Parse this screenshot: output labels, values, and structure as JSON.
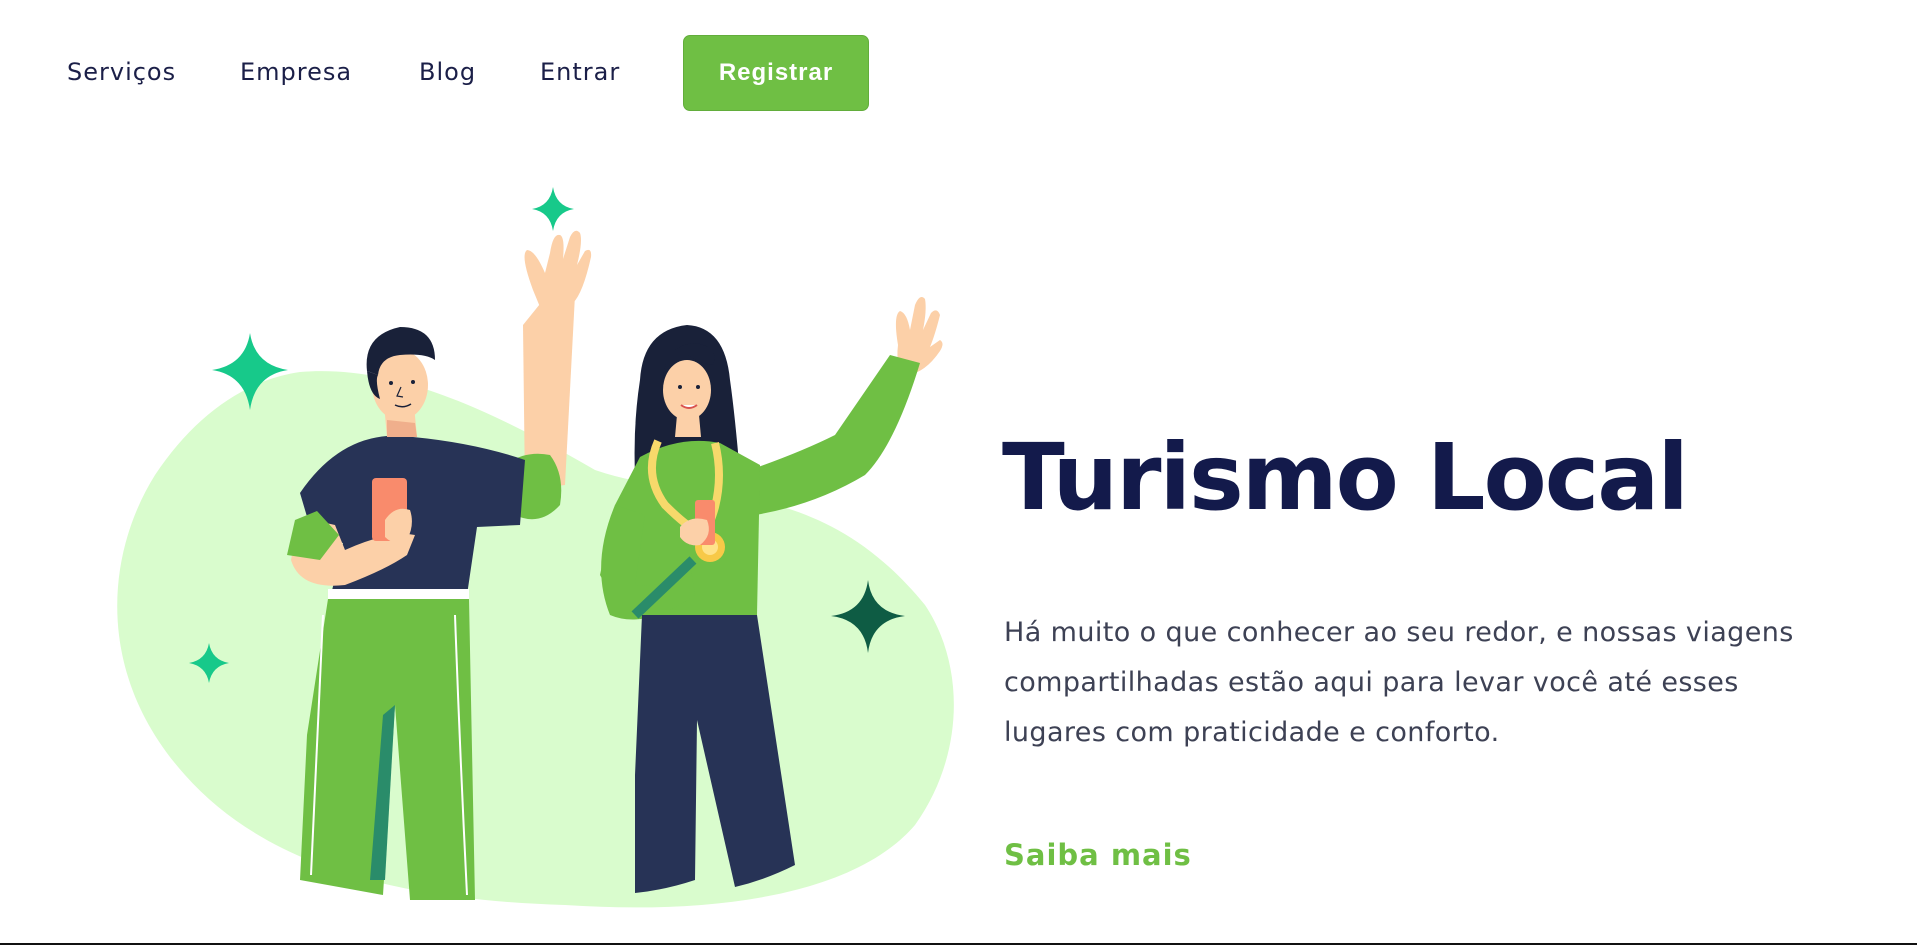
{
  "nav": {
    "links": [
      {
        "label": "Serviços"
      },
      {
        "label": "Empresa"
      },
      {
        "label": "Blog"
      },
      {
        "label": "Entrar"
      }
    ],
    "cta_label": "Registrar"
  },
  "hero": {
    "title": "Turismo Local",
    "description": "Há muito o que conhecer ao seu redor, e nossas viagens compartilhadas estão aqui para levar você até esses lugares com praticidade e conforto.",
    "link_label": "Saiba mais"
  },
  "colors": {
    "accent_green": "#6fbf44",
    "heading_navy": "#131a4b",
    "blob_green": "#d9fccd",
    "sparkle_teal": "#17c98a",
    "sparkle_dark": "#0e5c44",
    "skin": "#fcd0a8"
  },
  "illustration": {
    "icons": [
      "sparkle-icon",
      "phone-icon",
      "medal-icon"
    ]
  }
}
